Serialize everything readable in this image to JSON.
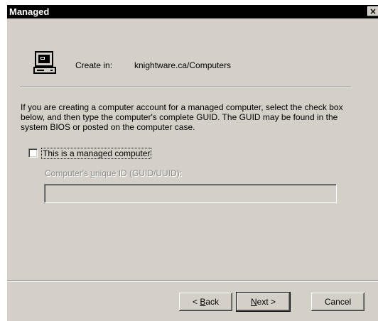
{
  "window": {
    "title": "Managed",
    "close_glyph": "×"
  },
  "header": {
    "icon": "computer-icon",
    "create_in_label": "Create in:",
    "create_in_path": "knightware.ca/Computers"
  },
  "description": "If you are creating a computer account for a managed computer, select the check box below, and then type the computer's complete GUID. The GUID may be found in the system BIOS or posted on the computer case.",
  "managed_checkbox": {
    "label": "This is a managed computer",
    "checked": false
  },
  "guid": {
    "label_before": "Computer's ",
    "label_mnemonic": "u",
    "label_after": "nique ID (GUID/UUID):",
    "value": "",
    "enabled": false
  },
  "buttons": {
    "back_prefix": "< ",
    "back_mnemonic": "B",
    "back_rest": "ack",
    "next_mnemonic": "N",
    "next_rest": "ext >",
    "cancel": "Cancel"
  },
  "colors": {
    "dialog_bg": "#d4d0c8",
    "title_bar_bg": "#000000",
    "disabled_text": "#8a8a8a"
  }
}
